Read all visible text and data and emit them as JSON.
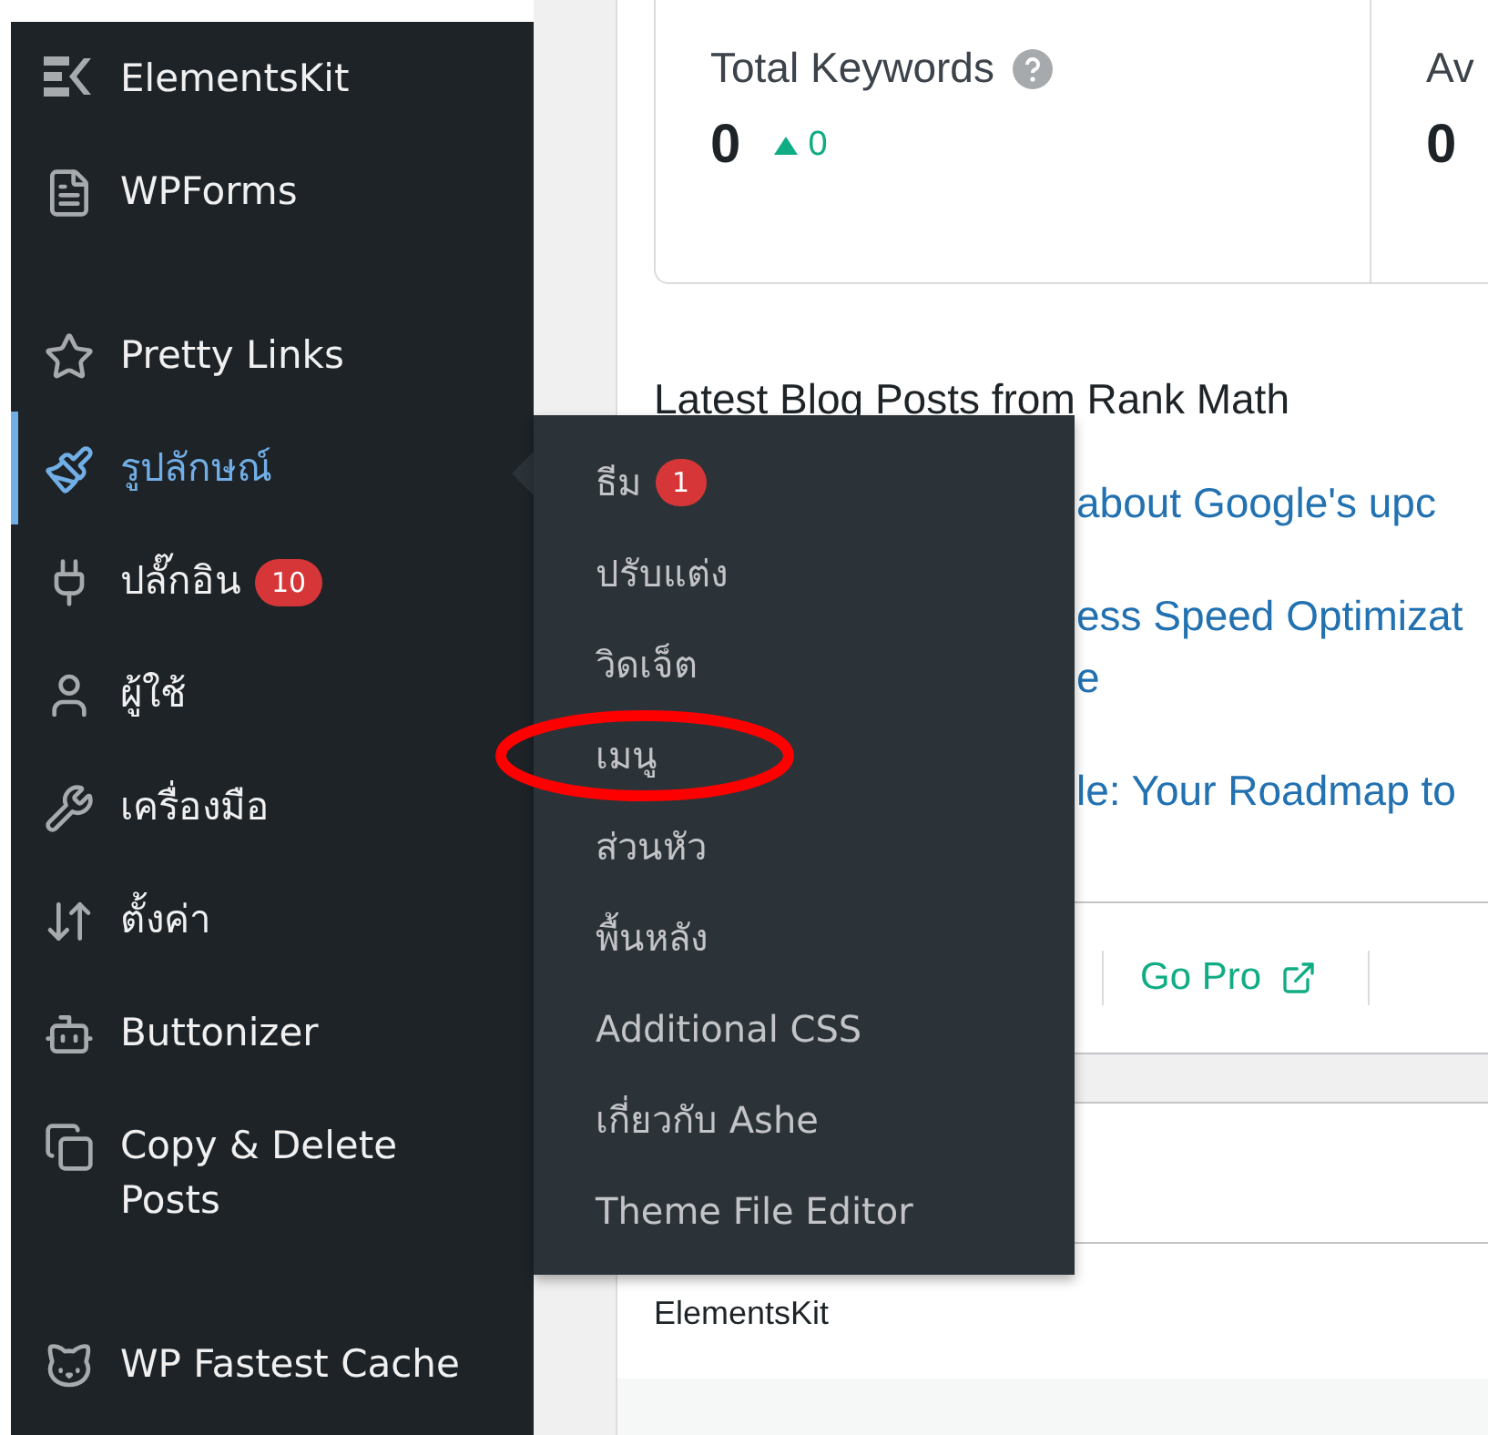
{
  "sidebar": {
    "groups": [
      [
        {
          "label": "ElementsKit",
          "selected": false
        },
        {
          "label": "WPForms",
          "selected": false
        }
      ],
      [
        {
          "label": "Pretty Links",
          "selected": false
        },
        {
          "label": "รูปลักษณ์",
          "selected": true
        },
        {
          "label": "ปลั๊กอิน",
          "selected": false,
          "badge": "10"
        },
        {
          "label": "ผู้ใช้",
          "selected": false
        },
        {
          "label": "เครื่องมือ",
          "selected": false
        },
        {
          "label": "ตั้งค่า",
          "selected": false
        },
        {
          "label": "Buttonizer",
          "selected": false
        },
        {
          "label": "Copy & Delete Posts",
          "selected": false
        }
      ],
      [
        {
          "label": "WP Fastest Cache",
          "selected": false
        }
      ]
    ]
  },
  "flyout": {
    "items": [
      {
        "label": "ธีม",
        "badge": "1",
        "circled": false
      },
      {
        "label": "ปรับแต่ง",
        "circled": false
      },
      {
        "label": "วิดเจ็ต",
        "circled": false
      },
      {
        "label": "เมนู",
        "circled": true
      },
      {
        "label": "ส่วนหัว",
        "circled": false
      },
      {
        "label": "พื้นหลัง",
        "circled": false
      },
      {
        "label": "Additional CSS",
        "circled": false
      },
      {
        "label": "เกี่ยวกับ Ashe",
        "circled": false
      },
      {
        "label": "Theme File Editor",
        "circled": false
      }
    ]
  },
  "stats": [
    {
      "label": "Total Keywords",
      "value": "0",
      "change": "0",
      "rising": true,
      "help": true
    },
    {
      "label": "Av",
      "value": "0"
    }
  ],
  "blog": {
    "title": "Latest Blog Posts from Rank Math",
    "posts": [
      [
        "about Google's upc"
      ],
      [
        "ess Speed Optimizat",
        "e"
      ],
      [
        "le: Your Roadmap to"
      ]
    ]
  },
  "footer_link": "Go Pro",
  "section_label": "ElementsKit"
}
